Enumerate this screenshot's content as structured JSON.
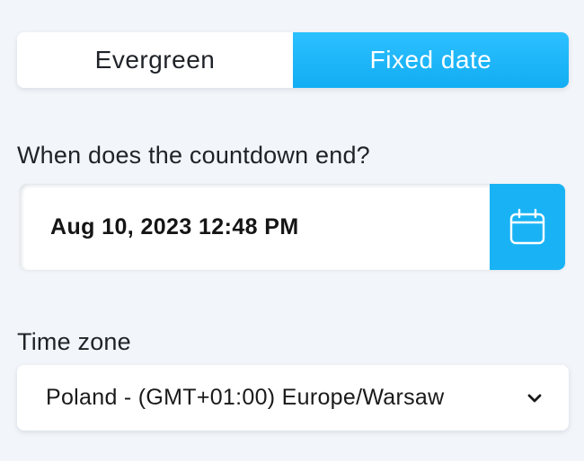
{
  "countdown_type": {
    "options": [
      {
        "label": "Evergreen",
        "selected": false
      },
      {
        "label": "Fixed date",
        "selected": true
      }
    ]
  },
  "end_date": {
    "label": "When does the countdown end?",
    "value": "Aug 10, 2023 12:48 PM",
    "button_icon": "calendar-icon"
  },
  "time_zone": {
    "label": "Time zone",
    "selected": "Poland - (GMT+01:00) Europe/Warsaw",
    "icon": "chevron-down-icon"
  },
  "colors": {
    "accent": "#19b3f5",
    "background": "#f2f5f9",
    "surface": "#ffffff",
    "text": "#1f2328"
  }
}
